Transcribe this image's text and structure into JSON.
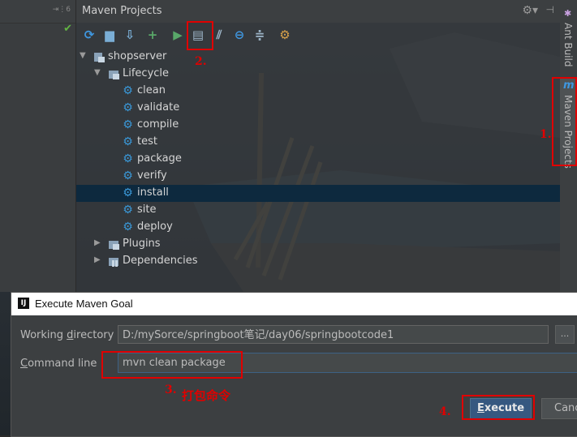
{
  "left_strip": {
    "header_text": "⇥⋮6"
  },
  "maven_panel": {
    "title": "Maven Projects",
    "toolbar": [
      {
        "icon": "refresh-icon",
        "glyph": "⟳",
        "color": "#3f97e0"
      },
      {
        "icon": "add-folder-icon",
        "glyph": "▆",
        "color": "#7aaed6"
      },
      {
        "icon": "download-icon",
        "glyph": "⇩",
        "color": "#7aaed6"
      },
      {
        "icon": "plus-icon",
        "glyph": "+",
        "color": "#59a869"
      },
      {
        "icon": "run-icon",
        "glyph": "▶",
        "color": "#59a869"
      },
      {
        "icon": "execute-goal-icon",
        "glyph": "▤",
        "color": "#9db5c8"
      },
      {
        "icon": "toggle-offline-icon",
        "glyph": "⫽",
        "color": "#9db5c8"
      },
      {
        "icon": "skip-tests-icon",
        "glyph": "⊖",
        "color": "#3f97e0"
      },
      {
        "icon": "collapse-icon",
        "glyph": "≑",
        "color": "#9db5c8"
      },
      {
        "icon": "settings-icon",
        "glyph": "⚙",
        "color": "#d8a24a"
      }
    ],
    "tree": {
      "project": "shopserver",
      "lifecycle": "Lifecycle",
      "goals": [
        "clean",
        "validate",
        "compile",
        "test",
        "package",
        "verify",
        "install",
        "site",
        "deploy"
      ],
      "selected_goal": "install",
      "plugins": "Plugins",
      "dependencies": "Dependencies"
    }
  },
  "right_strip": {
    "tab1": "Ant Build",
    "tab2": "Maven Projects",
    "tab2_icon": "m"
  },
  "dialog": {
    "title": "Execute Maven Goal",
    "working_dir_label_pre": "Working ",
    "working_dir_label_u": "d",
    "working_dir_label_post": "irectory",
    "working_dir_value": "D:/mySorce/springboot笔记/day06/springbootcode1",
    "browse_label": "...",
    "cmd_label_u": "C",
    "cmd_label_post": "ommand line",
    "cmd_value": "mvn clean package",
    "execute_label_u": "E",
    "execute_label_post": "xecute",
    "cancel_label": "Cancel"
  },
  "annotations": {
    "step1": "1.",
    "step2": "2.",
    "step3": "3.",
    "step3_text": "打包命令",
    "step4": "4."
  },
  "colors": {
    "accent_red": "#e00000",
    "selection": "#0d293e",
    "execute_button": "#365880",
    "goal_icon": "#3a98d8"
  }
}
